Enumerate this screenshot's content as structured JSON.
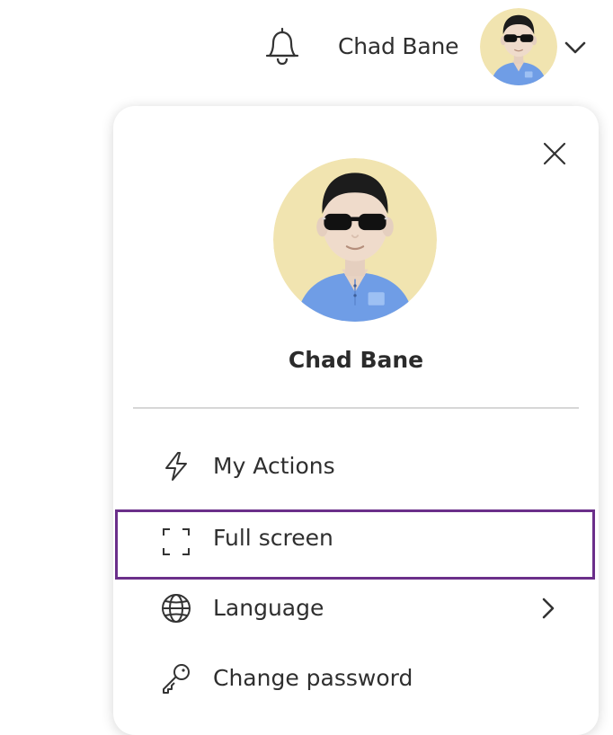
{
  "header": {
    "user_name": "Chad Bane",
    "icons": [
      "bell-icon",
      "chevron-down-icon"
    ]
  },
  "profile_panel": {
    "user_name": "Chad Bane",
    "close_icon": "close-icon",
    "menu": [
      {
        "label": "My Actions",
        "icon": "lightning-icon"
      },
      {
        "label": "Full screen",
        "icon": "fullscreen-icon",
        "selected": true
      },
      {
        "label": "Language",
        "icon": "globe-icon",
        "has_submenu": true
      },
      {
        "label": "Change password",
        "icon": "key-icon"
      }
    ]
  },
  "colors": {
    "accent": "#6b2f8a",
    "avatar_background": "#f1e4b0",
    "shirt": "#6f9de6",
    "text": "#2f2f2f",
    "divider": "#d7d7d7"
  }
}
